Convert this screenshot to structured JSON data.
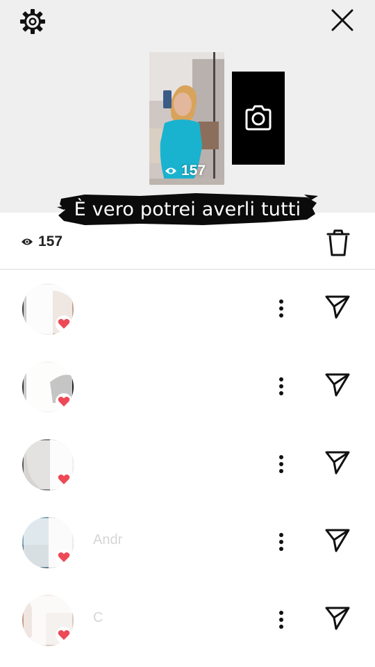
{
  "header": {
    "settings_icon": "gear-icon",
    "close_icon": "close-icon"
  },
  "story": {
    "thumbnail_views": "157",
    "camera_icon": "camera-icon"
  },
  "caption": {
    "text": "È vero potrei averli tutti"
  },
  "stats": {
    "views": "157",
    "delete_icon": "trash-icon"
  },
  "viewers": [
    {
      "name": "",
      "liked": true,
      "more_icon": "more-vertical-icon",
      "send_icon": "send-icon"
    },
    {
      "name": "",
      "liked": true,
      "more_icon": "more-vertical-icon",
      "send_icon": "send-icon"
    },
    {
      "name": "",
      "liked": true,
      "more_icon": "more-vertical-icon",
      "send_icon": "send-icon"
    },
    {
      "name": "Andr",
      "liked": true,
      "more_icon": "more-vertical-icon",
      "send_icon": "send-icon"
    },
    {
      "name": "C",
      "liked": true,
      "more_icon": "more-vertical-icon",
      "send_icon": "send-icon"
    }
  ],
  "colors": {
    "heart": "#ed4956",
    "caption_bg": "#0b0b0b",
    "top_bg": "#efefef"
  }
}
